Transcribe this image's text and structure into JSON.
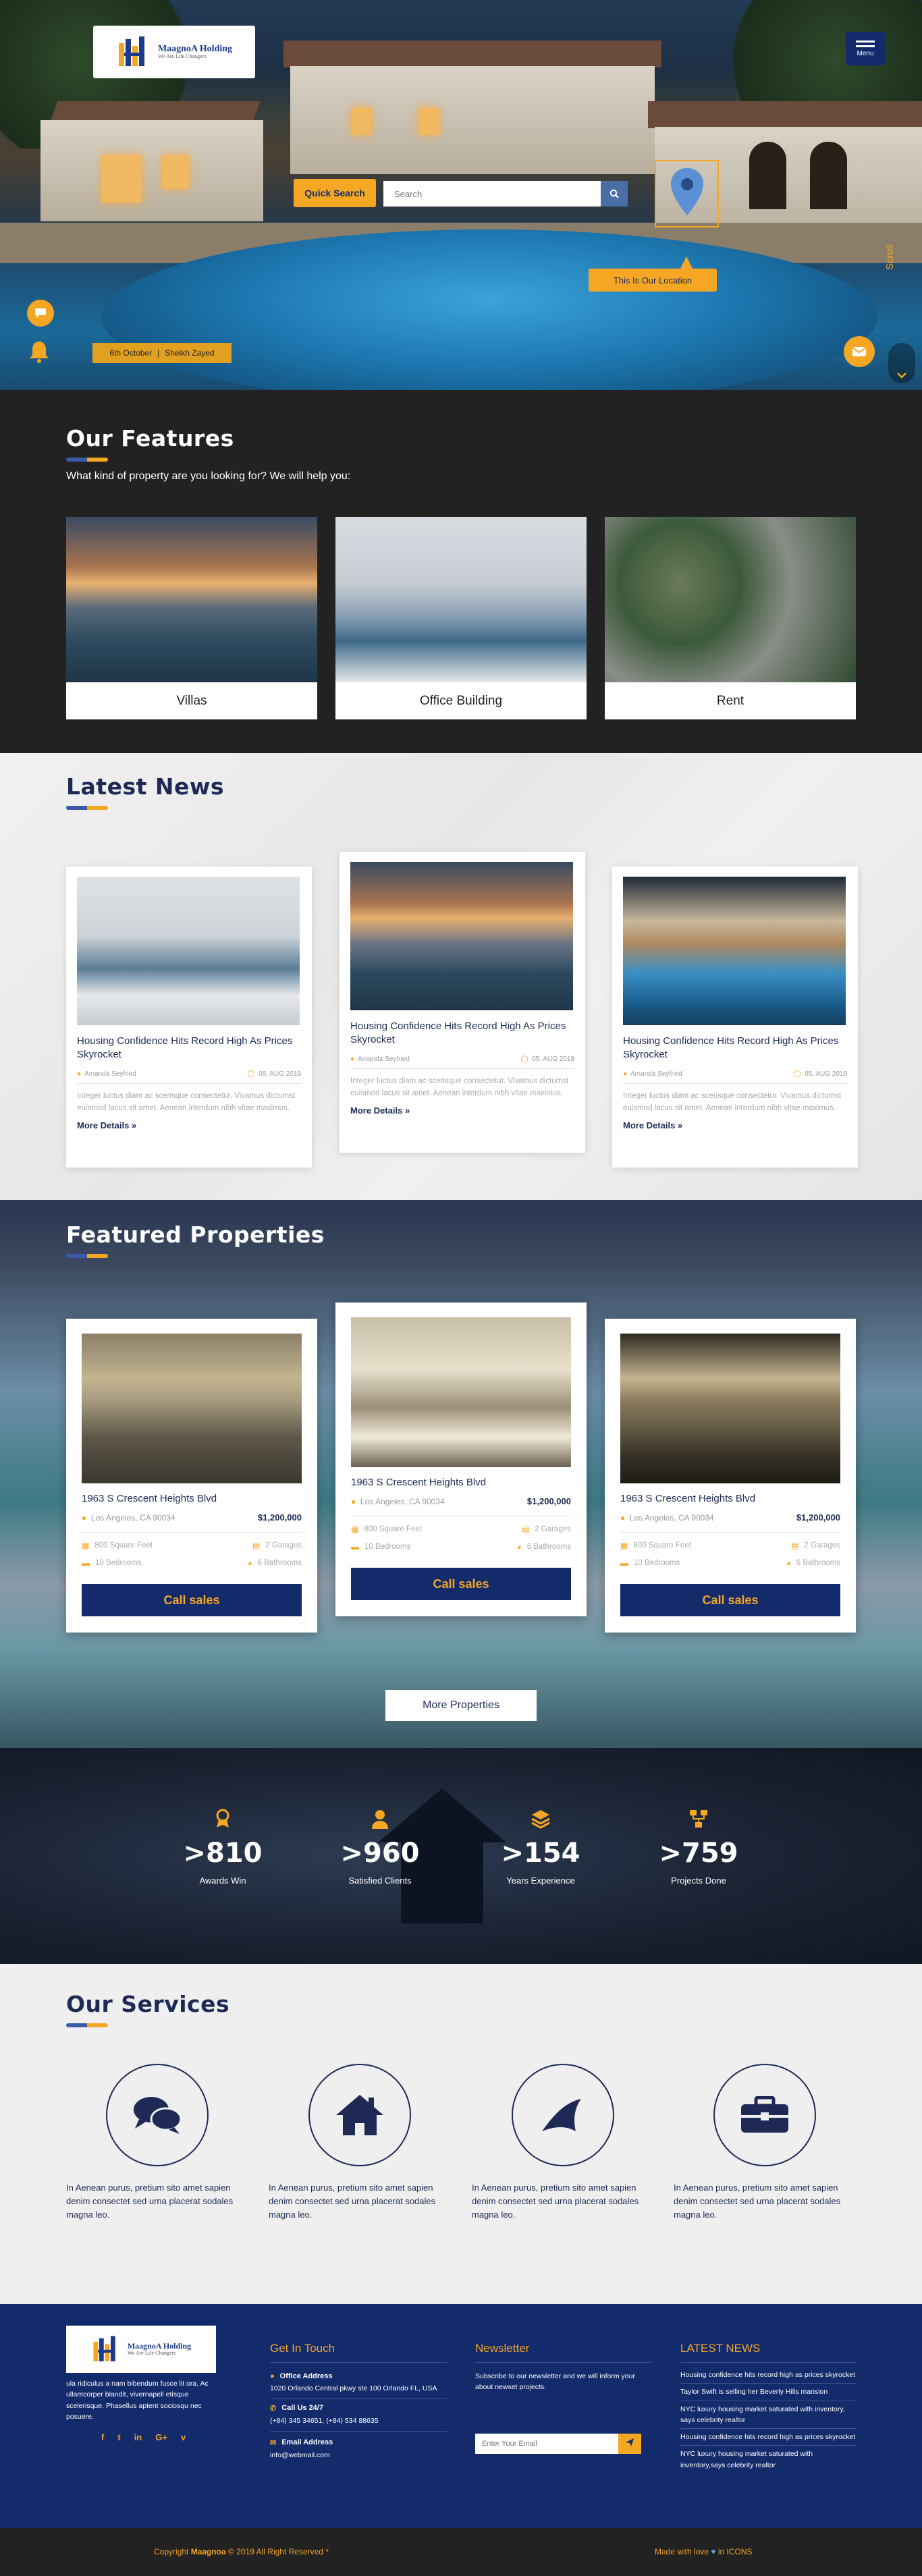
{
  "header": {
    "logo_name": "MaagnoA Holding",
    "logo_tagline": "We Are Life Changers",
    "menu_label": "Menu"
  },
  "hero": {
    "quick_search_label": "Quick Search",
    "search_placeholder": "Search",
    "location_label": "This Is Our Location",
    "date": "6th October",
    "date_separator": "|",
    "place": "Sheikh Zayed",
    "scroll_label": "Scroll"
  },
  "features": {
    "title": "Our Features",
    "subtitle": "What kind of property are you looking for? We will help you:",
    "items": [
      {
        "label": "Villas"
      },
      {
        "label": "Office Building"
      },
      {
        "label": "Rent"
      }
    ]
  },
  "news": {
    "title": "Latest News",
    "items": [
      {
        "title": "Housing Confidence Hits Record High As Prices Skyrocket",
        "author": "Amanda Seyfried",
        "date": "05, AUG 2019",
        "body": "Integer luctus diam ac scerisque consectetur. Vivamus dictumst euismod lacus sit amet. Aenean interdum nibh vitae maximus.",
        "more": "More Details"
      },
      {
        "title": "Housing Confidence Hits Record High As Prices Skyrocket",
        "author": "Amanda Seyfried",
        "date": "05, AUG 2019",
        "body": "Integer luctus diam ac scerisque consectetur. Vivamus dictumst euismod lacus sit amet. Aenean interdum nibh vitae maximus.",
        "more": "More Details"
      },
      {
        "title": "Housing Confidence Hits Record High As Prices Skyrocket",
        "author": "Amanda Seyfried",
        "date": "05, AUG 2019",
        "body": "Integer luctus diam ac scerisque consectetur. Vivamus dictumst euismod lacus sit amet. Aenean interdum nibh vitae maximus.",
        "more": "More Details"
      }
    ]
  },
  "properties": {
    "title": "Featured Properties",
    "items": [
      {
        "address": "1963 S Crescent Heights Blvd",
        "city": "Los Angeles, CA 90034",
        "price": "$1,200,000",
        "area": "800 Square Feet",
        "garages": "2 Garages",
        "bedrooms": "10 Bedrooms",
        "bathrooms": "6 Bathrooms",
        "cta": "Call sales"
      },
      {
        "address": "1963 S Crescent Heights Blvd",
        "city": "Los Angeles, CA 90034",
        "price": "$1,200,000",
        "area": "800 Square Feet",
        "garages": "2 Garages",
        "bedrooms": "10 Bedrooms",
        "bathrooms": "6 Bathrooms",
        "cta": "Call sales"
      },
      {
        "address": "1963 S Crescent Heights Blvd",
        "city": "Los Angeles, CA 90034",
        "price": "$1,200,000",
        "area": "800 Square Feet",
        "garages": "2 Garages",
        "bedrooms": "10 Bedrooms",
        "bathrooms": "6 Bathrooms",
        "cta": "Call sales"
      }
    ],
    "more_label": "More Properties"
  },
  "stats": [
    {
      "value": ">810",
      "label": "Awards Win"
    },
    {
      "value": ">960",
      "label": "Satisfied Clients"
    },
    {
      "value": ">154",
      "label": "Years Experience"
    },
    {
      "value": ">759",
      "label": "Projects Done"
    }
  ],
  "services": {
    "title": "Our Services",
    "items": [
      {
        "icon": "chat-bubbles-icon",
        "text": "In Aenean purus, pretium sito amet sapien denim consectet sed urna placerat sodales magna leo."
      },
      {
        "icon": "house-icon",
        "text": "In Aenean purus, pretium sito amet sapien denim consectet sed urna placerat sodales magna leo."
      },
      {
        "icon": "fin-icon",
        "text": "In Aenean purus, pretium sito amet sapien denim consectet sed urna placerat sodales magna leo."
      },
      {
        "icon": "briefcase-icon",
        "text": "In Aenean purus, pretium sito amet sapien denim consectet sed urna placerat sodales magna leo."
      }
    ]
  },
  "footer": {
    "about": "ula ridiculus a nam bibendum fusce lit ora. Ac ullamcorper blandit, vivernapell etisque scelerisque. Phasellus aptent sociosqu nec posuere.",
    "get_in_touch_title": "Get In Touch",
    "office_label": "Office Address",
    "office_value": "1020 Orlando Central pkwy ste 100 Orlando FL, USA",
    "call_label": "Call Us 24/7",
    "call_value": "(+84) 345 34651, (+84) 534 88635",
    "email_label": "Email Address",
    "email_value": "info@webmail.com",
    "newsletter_title": "Newsletter",
    "newsletter_text": "Subscribe to our newsletter and we will inform your about newset projects.",
    "email_placeholder": "Enter Your Email",
    "latest_news_title": "LATEST NEWS",
    "latest_news": [
      "Housing confidence hits record high as prices skyrocket",
      "Taylor Swift is selling her Beverly Hills mansion",
      "NYC luxury housing market saturated with inventory, says celebrity realtor",
      "Housing confidence hits record high as prices skyrocket",
      "NYC luxury housing market saturated with inventory,says celebrity realtor"
    ],
    "socials": [
      "f",
      "t",
      "in",
      "G+",
      "v"
    ]
  },
  "copyright": {
    "prefix": "Copyright",
    "brand": "Maagnoa",
    "suffix": "© 2019 All Right Reserved *",
    "made_with": "Made with love",
    "heart": "♥",
    "by": "in ICONS"
  },
  "colors": {
    "navy": "#132a6b",
    "orange": "#f5a623",
    "dark": "#222222"
  }
}
